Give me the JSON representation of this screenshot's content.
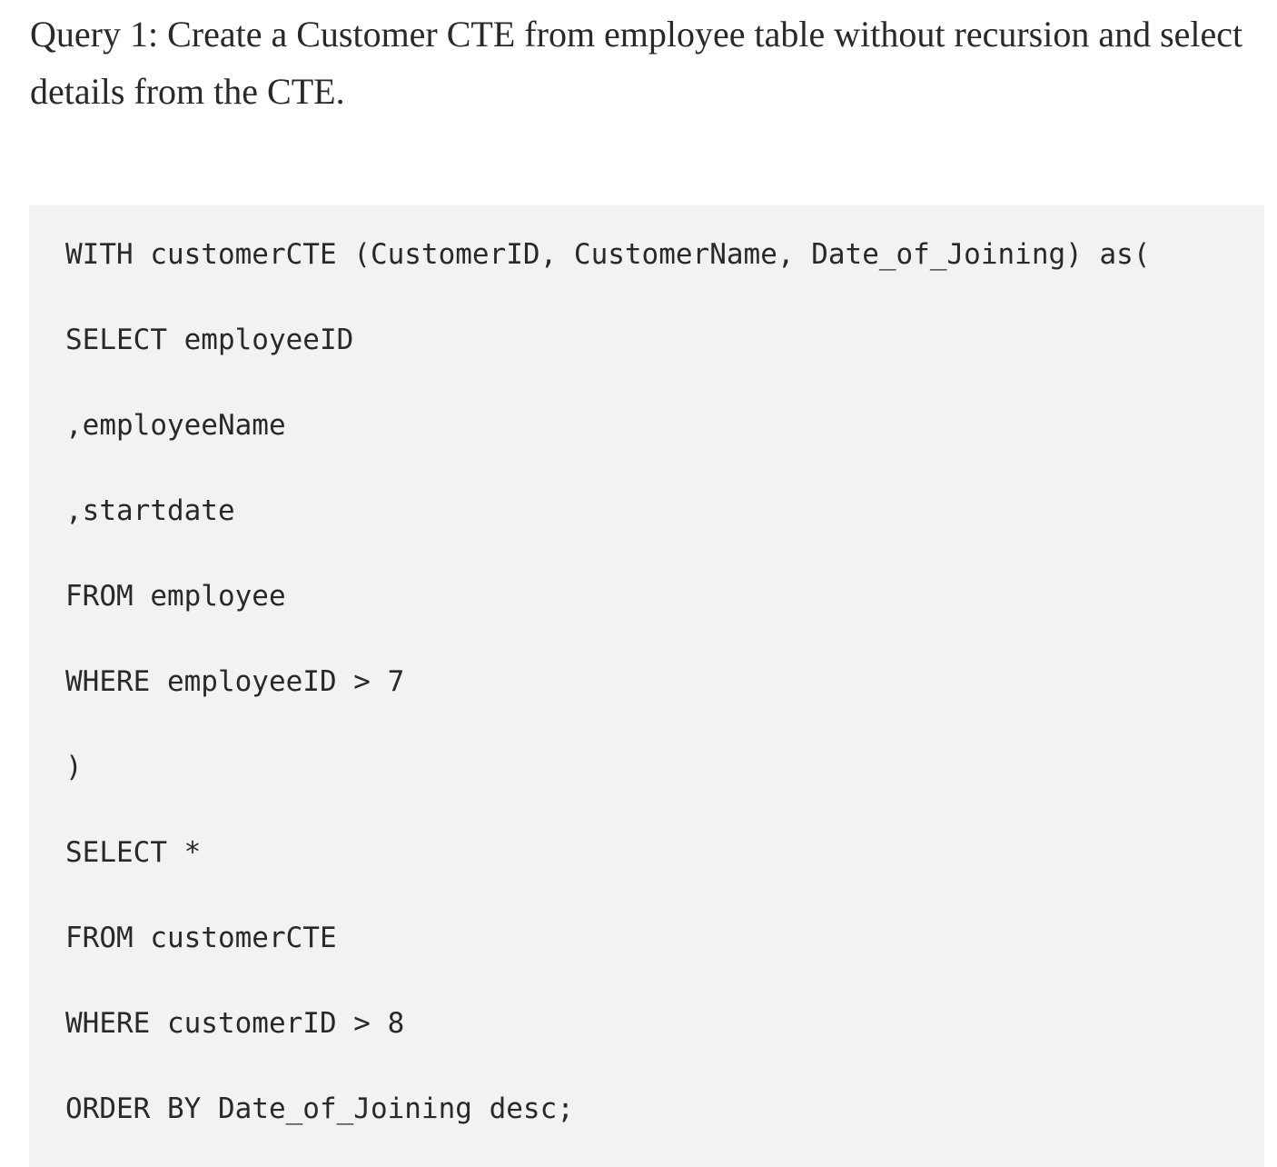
{
  "article": {
    "query_heading": "Query 1: Create a Customer CTE from employee table without recursion and select details from the CTE."
  },
  "code": {
    "lines": [
      "WITH customerCTE (CustomerID, CustomerName, Date_of_Joining) as(",
      "SELECT employeeID",
      ",employeeName",
      ",startdate",
      "FROM employee",
      "WHERE employeeID > 7",
      ")",
      "SELECT *",
      "FROM customerCTE",
      "WHERE customerID > 8",
      "ORDER BY Date_of_Joining desc;"
    ]
  }
}
